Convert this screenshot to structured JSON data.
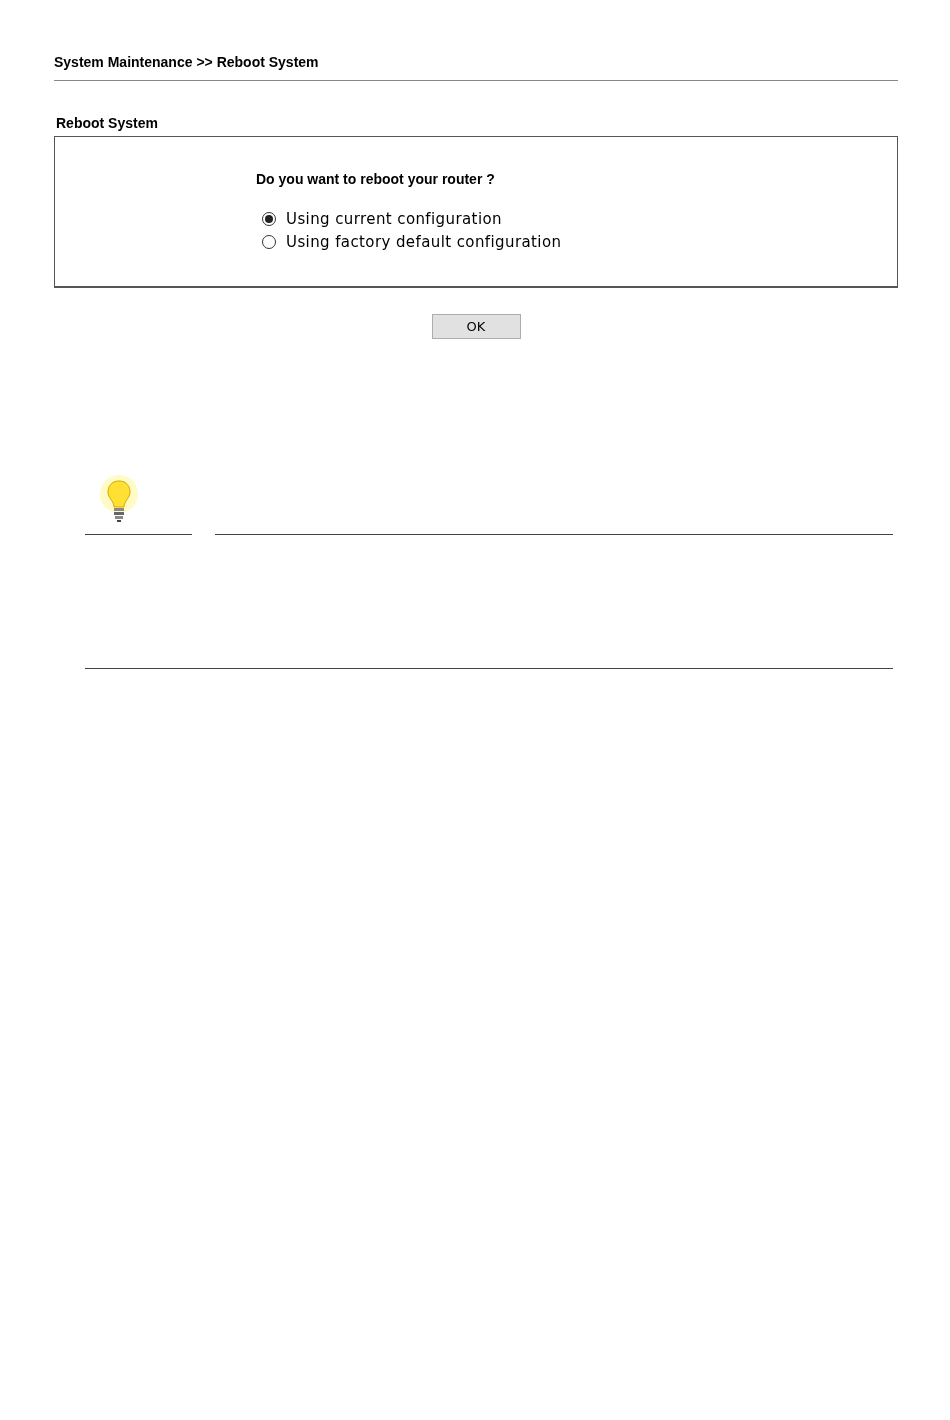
{
  "breadcrumb": "System Maintenance >> Reboot System",
  "section_title": "Reboot System",
  "question": "Do you want to reboot your router ?",
  "options": [
    {
      "label": "Using current configuration",
      "selected": true
    },
    {
      "label": "Using factory default configuration",
      "selected": false
    }
  ],
  "ok_button": "OK"
}
